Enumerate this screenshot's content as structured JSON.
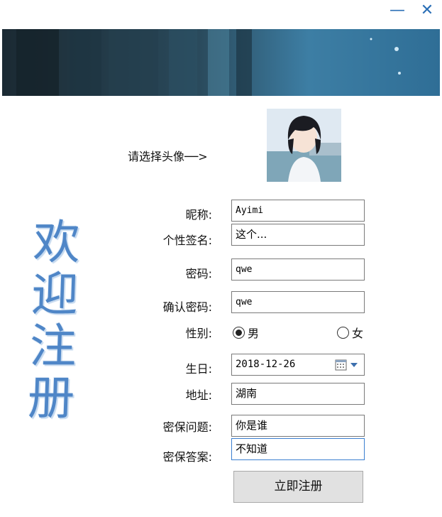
{
  "window": {
    "minimize_glyph": "—",
    "close_glyph": "✕",
    "accent": "#2b6fb6"
  },
  "avatar_prompt": "请选择头像──>",
  "welcome_chars": [
    "欢",
    "迎",
    "注",
    "册"
  ],
  "form": {
    "nickname": {
      "label": "昵称:",
      "value": "Ayimi"
    },
    "signature": {
      "label": "个性签名:",
      "value": "这个..."
    },
    "password": {
      "label": "密码:",
      "value": "qwe"
    },
    "confirm_password": {
      "label": "确认密码:",
      "value": "qwe"
    },
    "gender": {
      "label": "性别:",
      "options": [
        "男",
        "女"
      ],
      "selected": "男"
    },
    "birthday": {
      "label": "生日:",
      "value": "2018-12-26"
    },
    "address": {
      "label": "地址:",
      "value": "湖南"
    },
    "security_question": {
      "label": "密保问题:",
      "value": "你是谁"
    },
    "security_answer": {
      "label": "密保答案:",
      "value": "不知道"
    }
  },
  "register_button": "立即注册",
  "icons": {
    "minimize": "minimize-icon",
    "close": "close-icon",
    "calendar": "calendar-icon",
    "dropdown": "chevron-down-icon"
  }
}
